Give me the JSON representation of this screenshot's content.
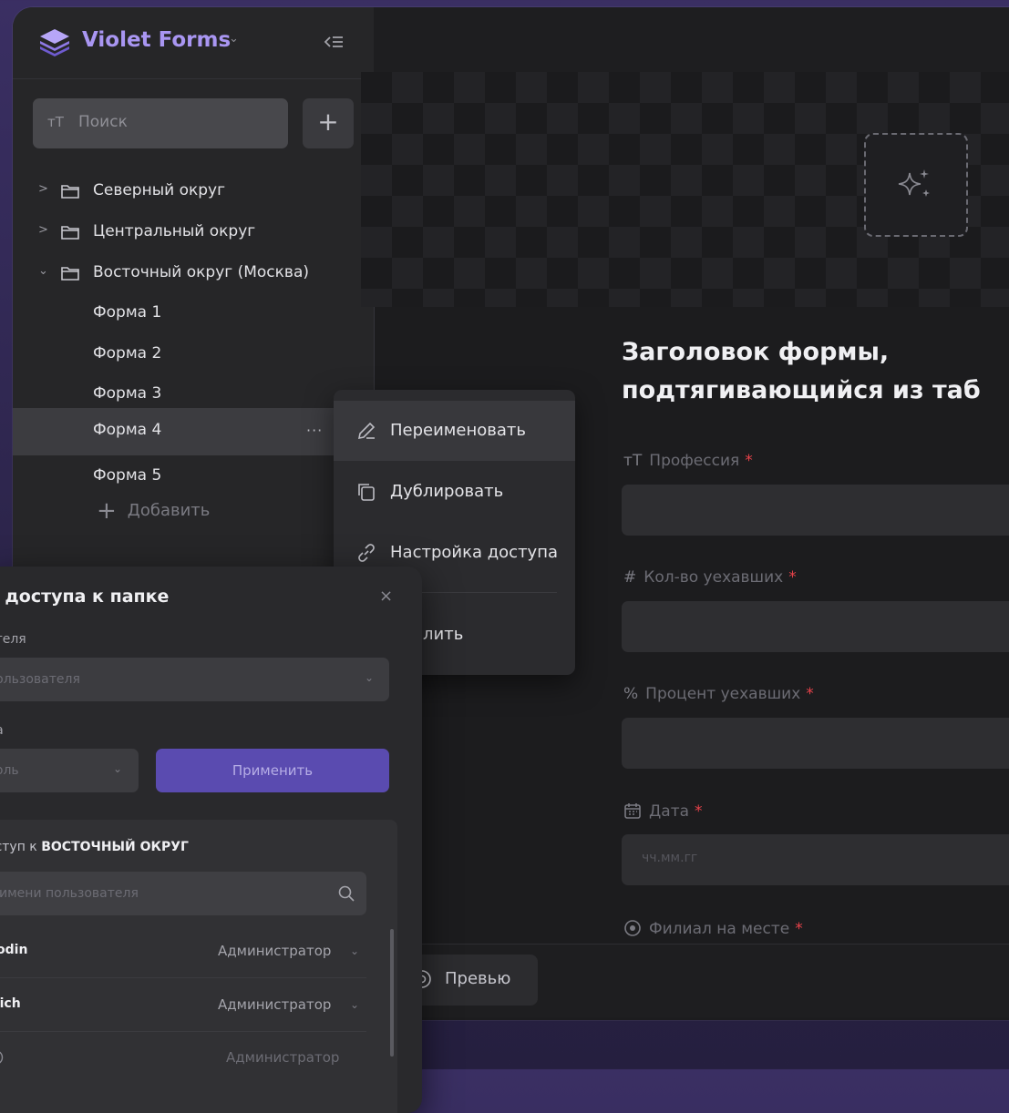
{
  "sidebar": {
    "brand": "Violet Forms",
    "search_placeholder": "Поиск",
    "search_prefix": "тТ",
    "add_button": "+",
    "tree": [
      {
        "label": "Северный округ",
        "expanded": false
      },
      {
        "label": "Центральный округ",
        "expanded": false
      },
      {
        "label": "Восточный округ (Москва)",
        "expanded": true
      }
    ],
    "forms": [
      "Форма 1",
      "Форма 2",
      "Форма 3",
      "Форма 4",
      "Форма 5"
    ],
    "active_form": "Форма 4",
    "row_menu": "···",
    "add_item": "Добавить"
  },
  "context_menu": {
    "items": [
      "Переименовать",
      "Дублировать",
      "Настройка доступа"
    ],
    "delete_partial": "лить"
  },
  "main": {
    "title_line1": "Заголовок формы,",
    "title_line2": "подтягивающийся из таб",
    "fields": [
      {
        "icon": "тТ",
        "label": "Профессия"
      },
      {
        "icon": "#",
        "label": "Кол-во уехавших"
      },
      {
        "icon": "%",
        "label": "Процент уехавших"
      },
      {
        "icon": "calendar",
        "label": "Дата",
        "placeholder": "чч.мм.гг"
      },
      {
        "icon": "radio",
        "label": "Филиал на месте"
      }
    ],
    "required_mark": "*",
    "preview_button": "Превью"
  },
  "modal": {
    "title": "а доступа к папке",
    "close": "×",
    "user_label": "ателя",
    "user_placeholder": "пользователя",
    "role_label": "па",
    "role_placeholder": "роль",
    "apply_button": "Применить",
    "access_title_prefix": "оступ к",
    "access_title_bold": "ВОСТОЧНЫЙ ОКРУГ",
    "access_search_placeholder": "о имени пользователя",
    "users": [
      {
        "name": "godin",
        "role": "Администратор"
      },
      {
        "name": "trich",
        "role": "Администратор"
      },
      {
        "name": "",
        "role": "Администратор"
      }
    ]
  },
  "colors": {
    "accent": "#a996f2",
    "apply_button": "#5a4bb0",
    "required": "#e8424a"
  }
}
